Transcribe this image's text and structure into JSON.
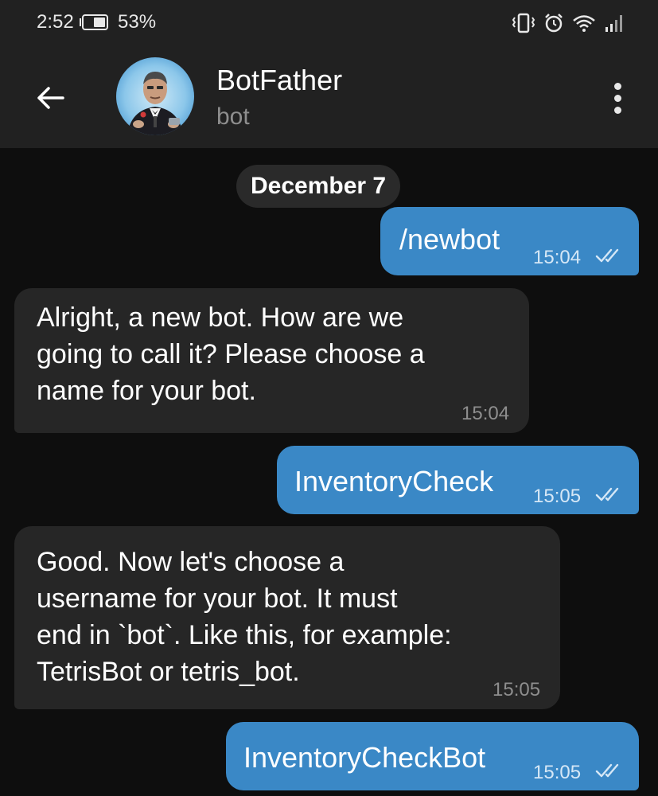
{
  "status_bar": {
    "time": "2:52",
    "battery_percent": "53%",
    "icons": [
      "battery-icon",
      "vibrate-icon",
      "alarm-icon",
      "wifi-icon",
      "signal-icon"
    ]
  },
  "header": {
    "title": "BotFather",
    "subtitle": "bot",
    "icons": [
      "back-arrow-icon",
      "avatar",
      "more-vert-icon"
    ]
  },
  "chat": {
    "date_separator": "December 7",
    "messages": [
      {
        "direction": "outgoing",
        "text": "/newbot",
        "time": "15:04",
        "status": "read"
      },
      {
        "direction": "incoming",
        "text": "Alright, a new bot. How are we\ngoing to call it? Please choose a\nname for your bot.",
        "time": "15:04"
      },
      {
        "direction": "outgoing",
        "text": "InventoryCheck",
        "time": "15:05",
        "status": "read"
      },
      {
        "direction": "incoming",
        "text": "Good. Now let's choose a\nusername for your bot. It must\nend in `bot`. Like this, for example:\nTetrisBot or tetris_bot.",
        "time": "15:05"
      },
      {
        "direction": "outgoing",
        "text": "InventoryCheckBot",
        "time": "15:05",
        "status": "read"
      }
    ]
  },
  "colors": {
    "background": "#0e0e0e",
    "bar": "#212121",
    "outgoing_bubble": "#3a88c6",
    "incoming_bubble": "#262626"
  }
}
